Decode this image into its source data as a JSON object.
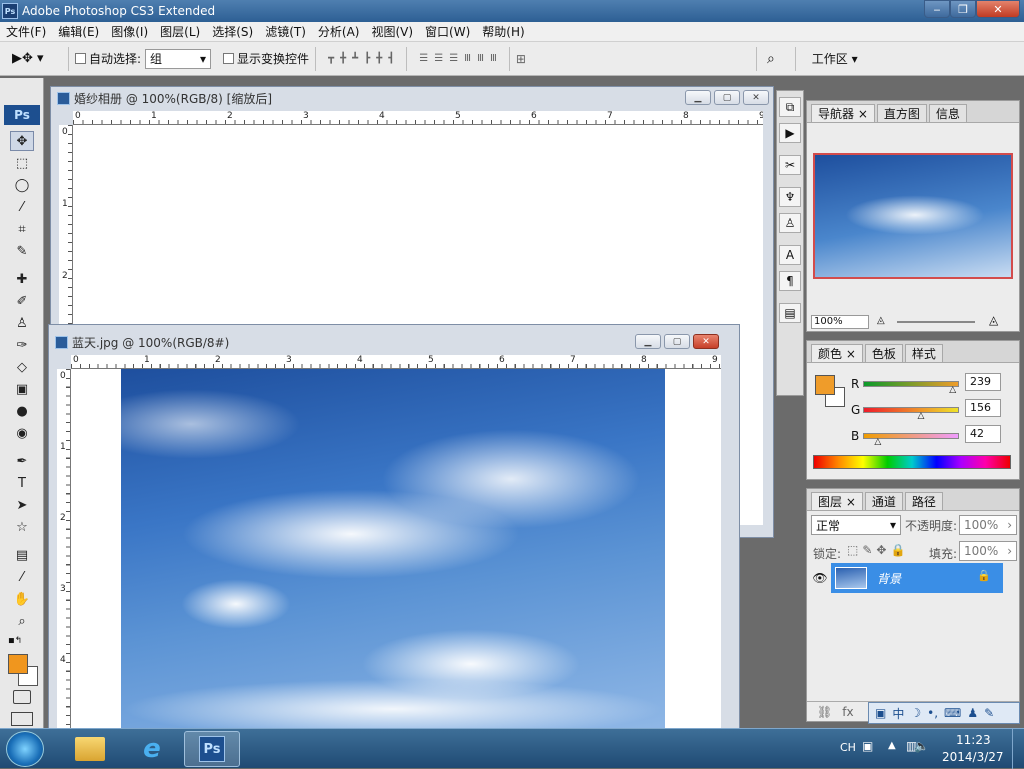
{
  "app": {
    "title": "Adobe Photoshop CS3 Extended",
    "icon_label": "Ps",
    "window_buttons": [
      "‒",
      "❐",
      "✕"
    ]
  },
  "menu": [
    "文件(F)",
    "编辑(E)",
    "图像(I)",
    "图层(L)",
    "选择(S)",
    "滤镜(T)",
    "分析(A)",
    "视图(V)",
    "窗口(W)",
    "帮助(H)"
  ],
  "options": {
    "auto_select_label": "自动选择:",
    "auto_select_value": "组",
    "show_transform_label": "显示变换控件",
    "workspace_label": "工作区 ▾"
  },
  "toolbox": {
    "logo": "Ps",
    "fg_color": "#f0961e",
    "bg_color": "#ffffff"
  },
  "doc1": {
    "title": "婚纱相册 @ 100%(RGB/8) [缩放后]",
    "ruler_h": [
      "0",
      "1",
      "2",
      "3",
      "4",
      "5",
      "6",
      "7",
      "8",
      "9"
    ],
    "ruler_v": [
      "0",
      "1",
      "2"
    ]
  },
  "doc2": {
    "title": "蓝天.jpg @ 100%(RGB/8#)",
    "ruler_h": [
      "0",
      "1",
      "2",
      "3",
      "4",
      "5",
      "6",
      "7",
      "8",
      "9"
    ],
    "ruler_v": [
      "0",
      "1",
      "2",
      "3",
      "4"
    ]
  },
  "navigator": {
    "tabs": [
      "导航器",
      "直方图",
      "信息"
    ],
    "zoom": "100%"
  },
  "color": {
    "tabs": [
      "颜色",
      "色板",
      "样式"
    ],
    "channels": [
      {
        "label": "R",
        "value": "239",
        "fraction": 0.94
      },
      {
        "label": "G",
        "value": "156",
        "fraction": 0.61
      },
      {
        "label": "B",
        "value": "42",
        "fraction": 0.16
      }
    ],
    "fg": "#ef9c2a"
  },
  "layers": {
    "tabs": [
      "图层",
      "通道",
      "路径"
    ],
    "blend_mode": "正常",
    "opacity_label": "不透明度:",
    "opacity": "100%",
    "lock_label": "锁定:",
    "fill_label": "填充:",
    "fill": "100%",
    "layer_name": "背景"
  },
  "ime": {
    "items": [
      "中",
      "☽",
      "⌨"
    ]
  },
  "taskbar": {
    "lang": "CH",
    "time": "11:23",
    "date": "2014/3/27"
  }
}
